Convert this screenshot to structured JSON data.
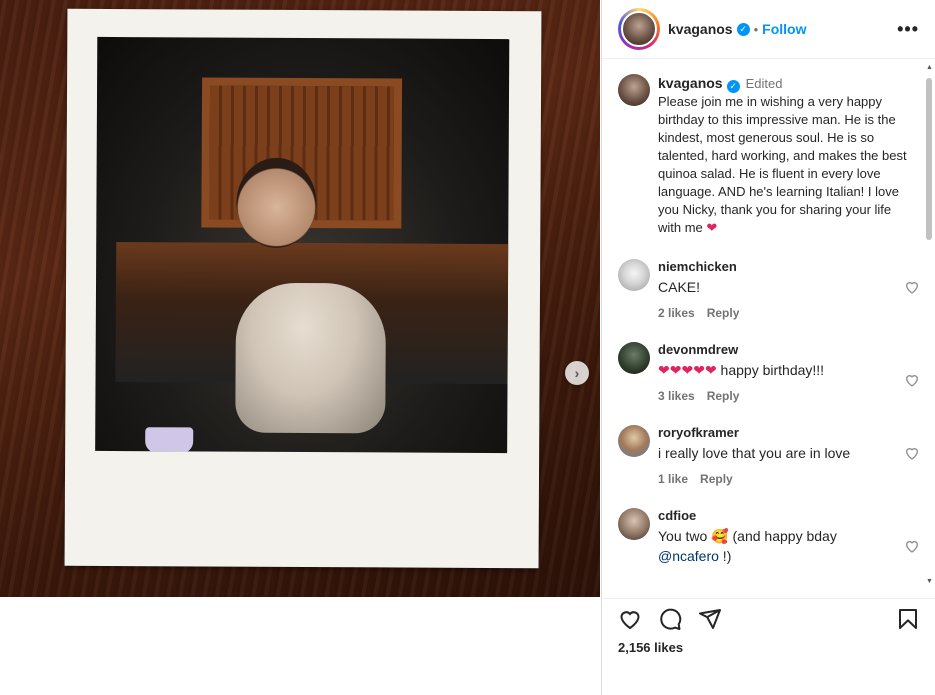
{
  "post": {
    "username": "kvaganos",
    "follow_label": "Follow",
    "separator": "•",
    "more_label": "•••",
    "next_label": "›"
  },
  "caption": {
    "username": "kvaganos",
    "edited": "Edited",
    "text": "Please join me in wishing a very happy birthday to this impressive man. He is the kindest, most generous soul. He is so talented, hard working, and makes the best quinoa salad. He is fluent in every love language. AND he's learning Italian! I love you Nicky, thank you for sharing your life with me ",
    "heart": "❤"
  },
  "comments": [
    {
      "username": "niemchicken",
      "text": "CAKE!",
      "likes": "2 likes",
      "reply": "Reply"
    },
    {
      "username": "devonmdrew",
      "text": "❤❤❤❤❤ happy birthday!!!",
      "likes": "3 likes",
      "reply": "Reply"
    },
    {
      "username": "roryofkramer",
      "text": "i really love that you are in love",
      "likes": "1 like",
      "reply": "Reply"
    },
    {
      "username": "cdfioe",
      "text_prefix": "You two 🥰 (and happy bday ",
      "mention": "@ncafero",
      "text_suffix": " !)"
    }
  ],
  "likes_count": "2,156 likes",
  "scrollbar": {
    "up": "▲",
    "down": "▼"
  },
  "colors": {
    "accent": "#0095f6",
    "heart": "#e0245e"
  },
  "icons": [
    "heart-icon",
    "comment-icon",
    "share-icon",
    "bookmark-icon",
    "more-options-icon",
    "verified-badge-icon",
    "next-arrow-icon"
  ]
}
